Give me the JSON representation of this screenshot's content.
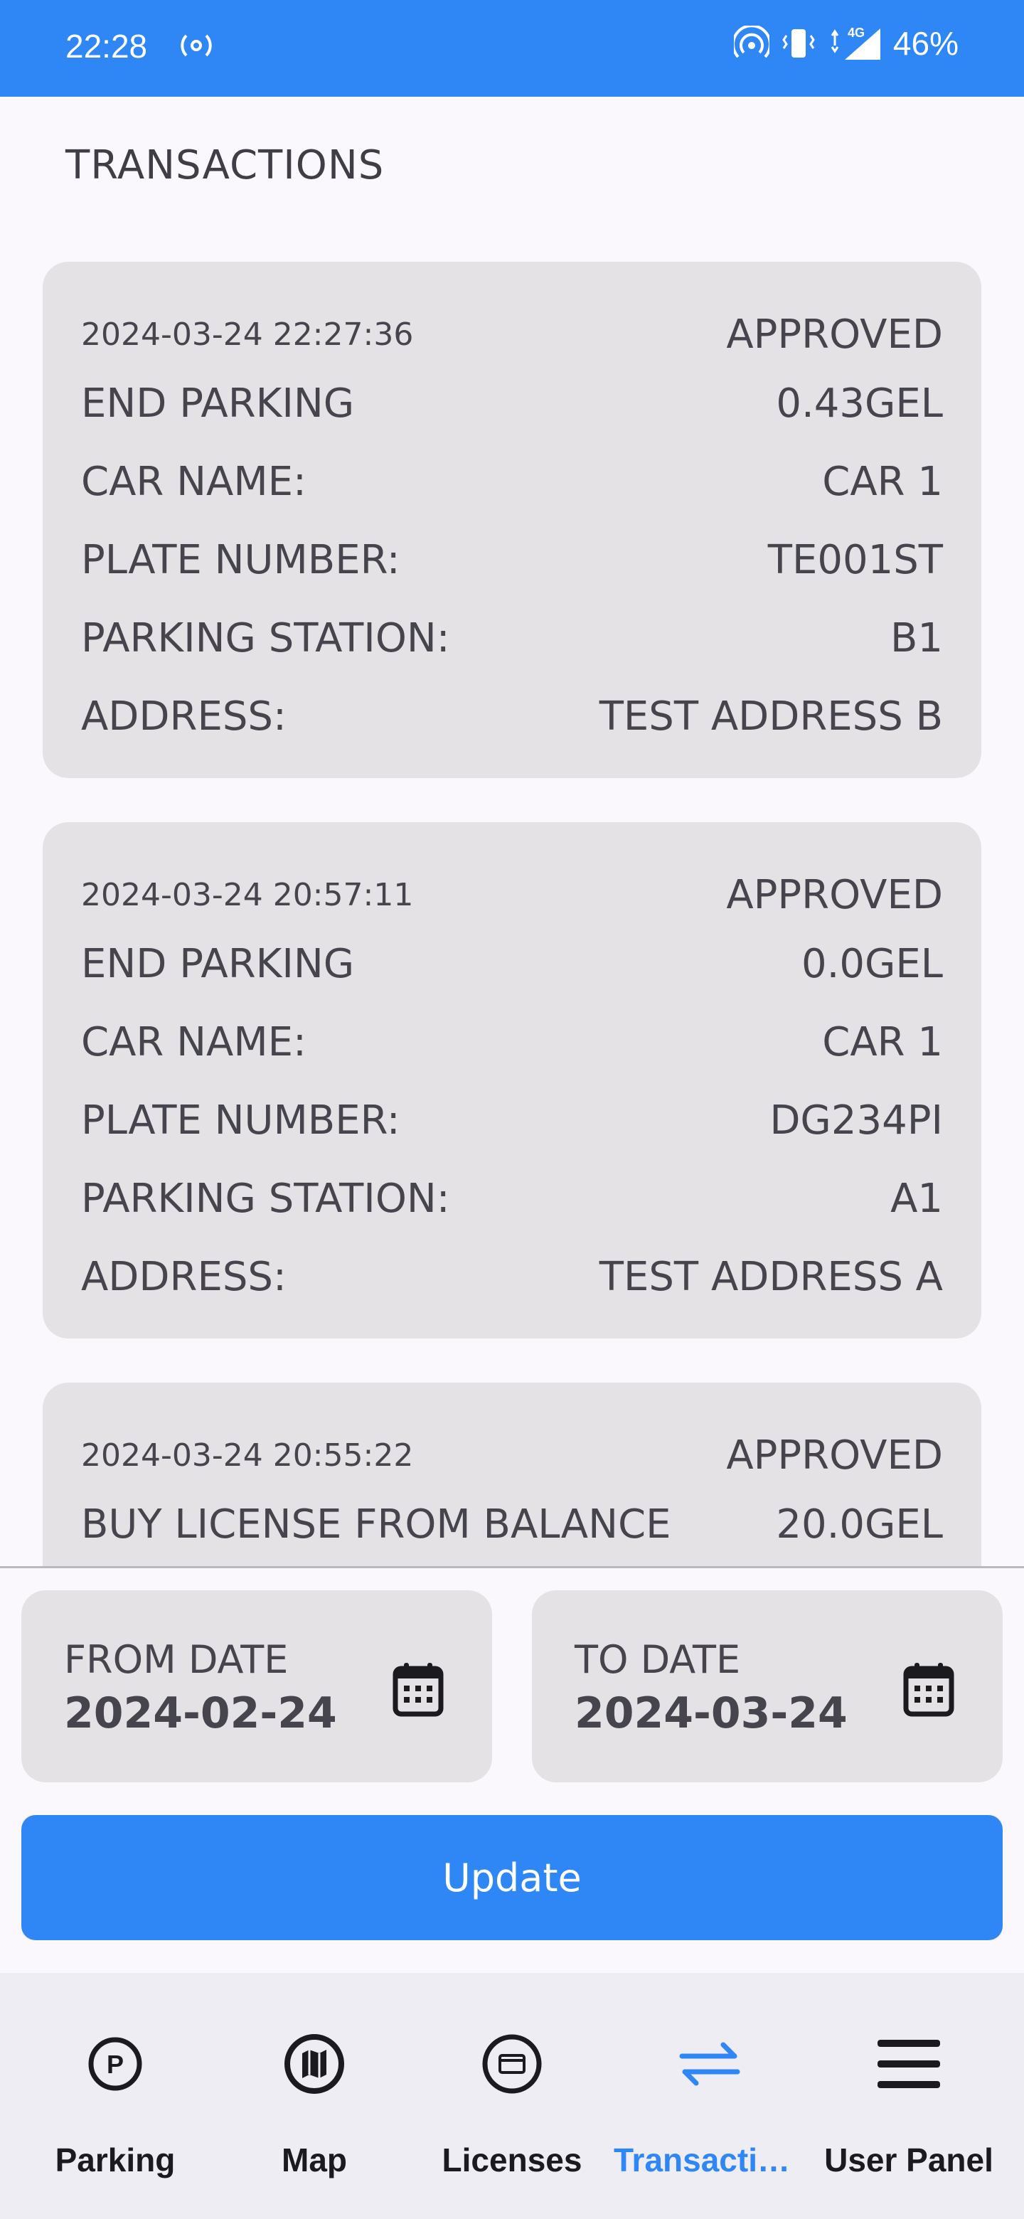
{
  "status_bar": {
    "time": "22:28",
    "battery": "46%",
    "network": "4G"
  },
  "page": {
    "title": "TRANSACTIONS"
  },
  "labels": {
    "car_name": "CAR NAME:",
    "plate_number": "PLATE NUMBER:",
    "parking_station": "PARKING STATION:",
    "address": "ADDRESS:"
  },
  "transactions": [
    {
      "timestamp": "2024-03-24 22:27:36",
      "status": "APPROVED",
      "type": "END PARKING",
      "amount": "0.43GEL",
      "car_name": "CAR 1",
      "plate_number": "TE001ST",
      "parking_station": "B1",
      "address": "TEST ADDRESS B"
    },
    {
      "timestamp": "2024-03-24 20:57:11",
      "status": "APPROVED",
      "type": "END PARKING",
      "amount": "0.0GEL",
      "car_name": "CAR 1",
      "plate_number": "DG234PI",
      "parking_station": "A1",
      "address": "TEST ADDRESS A"
    },
    {
      "timestamp": "2024-03-24 20:55:22",
      "status": "APPROVED",
      "type": "BUY LICENSE FROM BALANCE",
      "amount": "20.0GEL"
    }
  ],
  "filters": {
    "from_label": "FROM DATE",
    "from_value": "2024-02-24",
    "to_label": "TO DATE",
    "to_value": "2024-03-24",
    "update_label": "Update"
  },
  "nav": {
    "items": [
      {
        "label": "Parking",
        "icon": "parking-icon"
      },
      {
        "label": "Map",
        "icon": "map-icon"
      },
      {
        "label": "Licenses",
        "icon": "license-card-icon"
      },
      {
        "label": "Transactions",
        "icon": "swap-arrows-icon",
        "active": true
      },
      {
        "label": "User Panel",
        "icon": "menu-icon"
      }
    ]
  },
  "colors": {
    "accent": "#2f86f5",
    "card": "#e5e2e6",
    "background": "#fbf8fd"
  }
}
